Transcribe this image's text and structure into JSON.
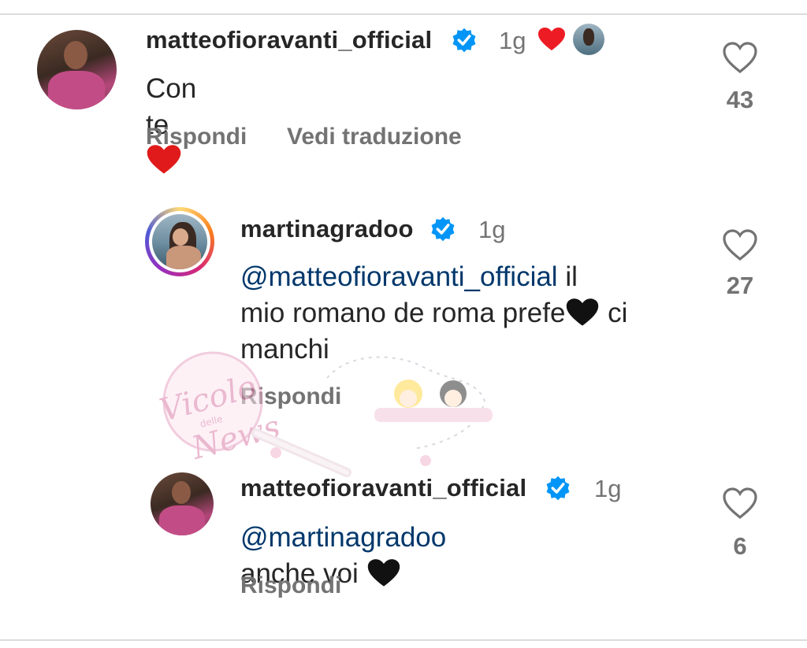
{
  "comments": [
    {
      "username": "matteofioravanti_official",
      "time": "1g",
      "text": "Con te",
      "liked_by_author": true,
      "actions": {
        "reply": "Rispondi",
        "translate": "Vedi traduzione"
      },
      "likes": "43"
    },
    {
      "username": "martinagradoo",
      "time": "1g",
      "mention": "@matteofioravanti_official",
      "text_line1_rest": " il",
      "text_line2": "mio romano de roma prefe",
      "text_line2_rest": " ci",
      "text_line3": "manchi",
      "actions": {
        "reply": "Rispondi"
      },
      "likes": "27"
    },
    {
      "username": "matteofioravanti_official",
      "time": "1g",
      "mention": "@martinagradoo",
      "text": " anche voi ",
      "actions": {
        "reply": "Rispondi"
      },
      "likes": "6"
    }
  ],
  "watermark": {
    "logo_text": "Vicolo delle News"
  },
  "colors": {
    "verified": "#0095f6",
    "mention": "#00376b",
    "red_heart": "#ed1c24",
    "black_heart": "#000000",
    "secondary_text": "#737373"
  }
}
